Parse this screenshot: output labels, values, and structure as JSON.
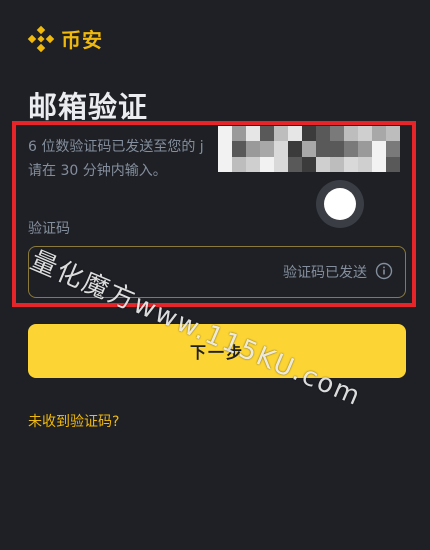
{
  "brand": {
    "name": "币安",
    "accent_color": "#f0b90b"
  },
  "page": {
    "title": "邮箱验证",
    "description_line1": "6 位数验证码已发送至您的 j",
    "description_line2": "请在 30 分钟内输入。"
  },
  "code_field": {
    "label": "验证码",
    "status_text": "验证码已发送",
    "icon": "info-icon"
  },
  "buttons": {
    "next": "下一步"
  },
  "links": {
    "no_code": "未收到验证码?"
  },
  "watermark": {
    "text": "量化魔方www.115KU.com"
  },
  "colors": {
    "background": "#1e2026",
    "primary_button": "#fcd535",
    "highlight_border": "#e5252a",
    "muted_text": "#848e9c"
  }
}
